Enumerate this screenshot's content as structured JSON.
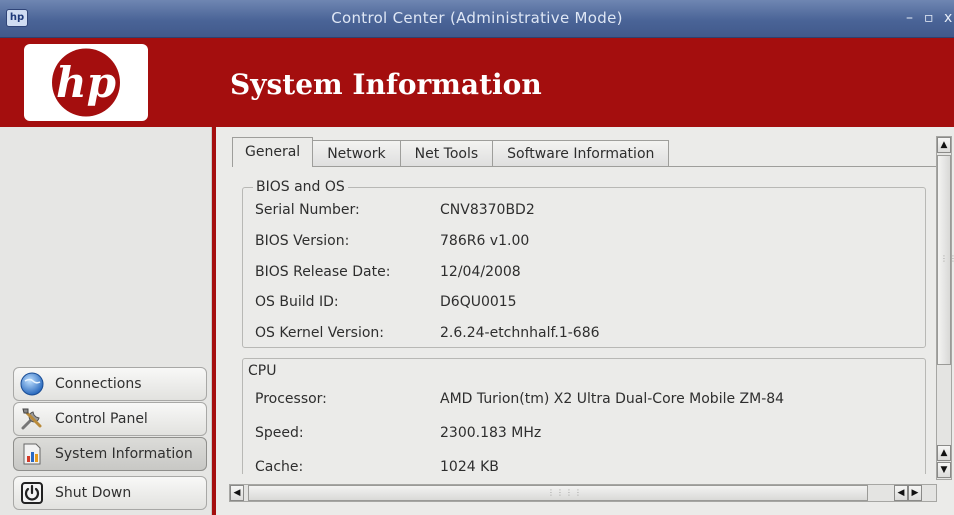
{
  "window": {
    "title": "Control Center (Administrative Mode)",
    "minimize": "–",
    "maximize": "▫",
    "close": "x",
    "app_icon": "hp-app-icon"
  },
  "header": {
    "title": "System Information",
    "logo": "hp-logo",
    "brand_color": "#a40e0e"
  },
  "sidebar": {
    "items": [
      {
        "label": "Connections",
        "icon": "globe-icon"
      },
      {
        "label": "Control Panel",
        "icon": "tools-icon"
      },
      {
        "label": "System Information",
        "icon": "chart-icon",
        "active": true
      },
      {
        "label": "Shut Down",
        "icon": "power-icon"
      }
    ]
  },
  "tabs": [
    {
      "label": "General",
      "active": true
    },
    {
      "label": "Network"
    },
    {
      "label": "Net Tools"
    },
    {
      "label": "Software Information"
    }
  ],
  "bios": {
    "legend": "BIOS and OS",
    "rows": [
      {
        "label": "Serial Number:",
        "value": "CNV8370BD2"
      },
      {
        "label": "BIOS Version:",
        "value": "786R6 v1.00"
      },
      {
        "label": "BIOS Release Date:",
        "value": "12/04/2008"
      },
      {
        "label": "OS Build ID:",
        "value": "D6QU0015"
      },
      {
        "label": "OS Kernel Version:",
        "value": "2.6.24-etchnhalf.1-686"
      }
    ]
  },
  "cpu": {
    "legend": "CPU",
    "rows": [
      {
        "label": "Processor:",
        "value": "AMD Turion(tm) X2 Ultra Dual-Core Mobile ZM-84"
      },
      {
        "label": "Speed:",
        "value": "2300.183 MHz"
      },
      {
        "label": "Cache:",
        "value": "1024 KB"
      }
    ]
  },
  "scrollbars": {
    "up": "▲",
    "down": "▼",
    "left": "◀",
    "right": "▶"
  }
}
